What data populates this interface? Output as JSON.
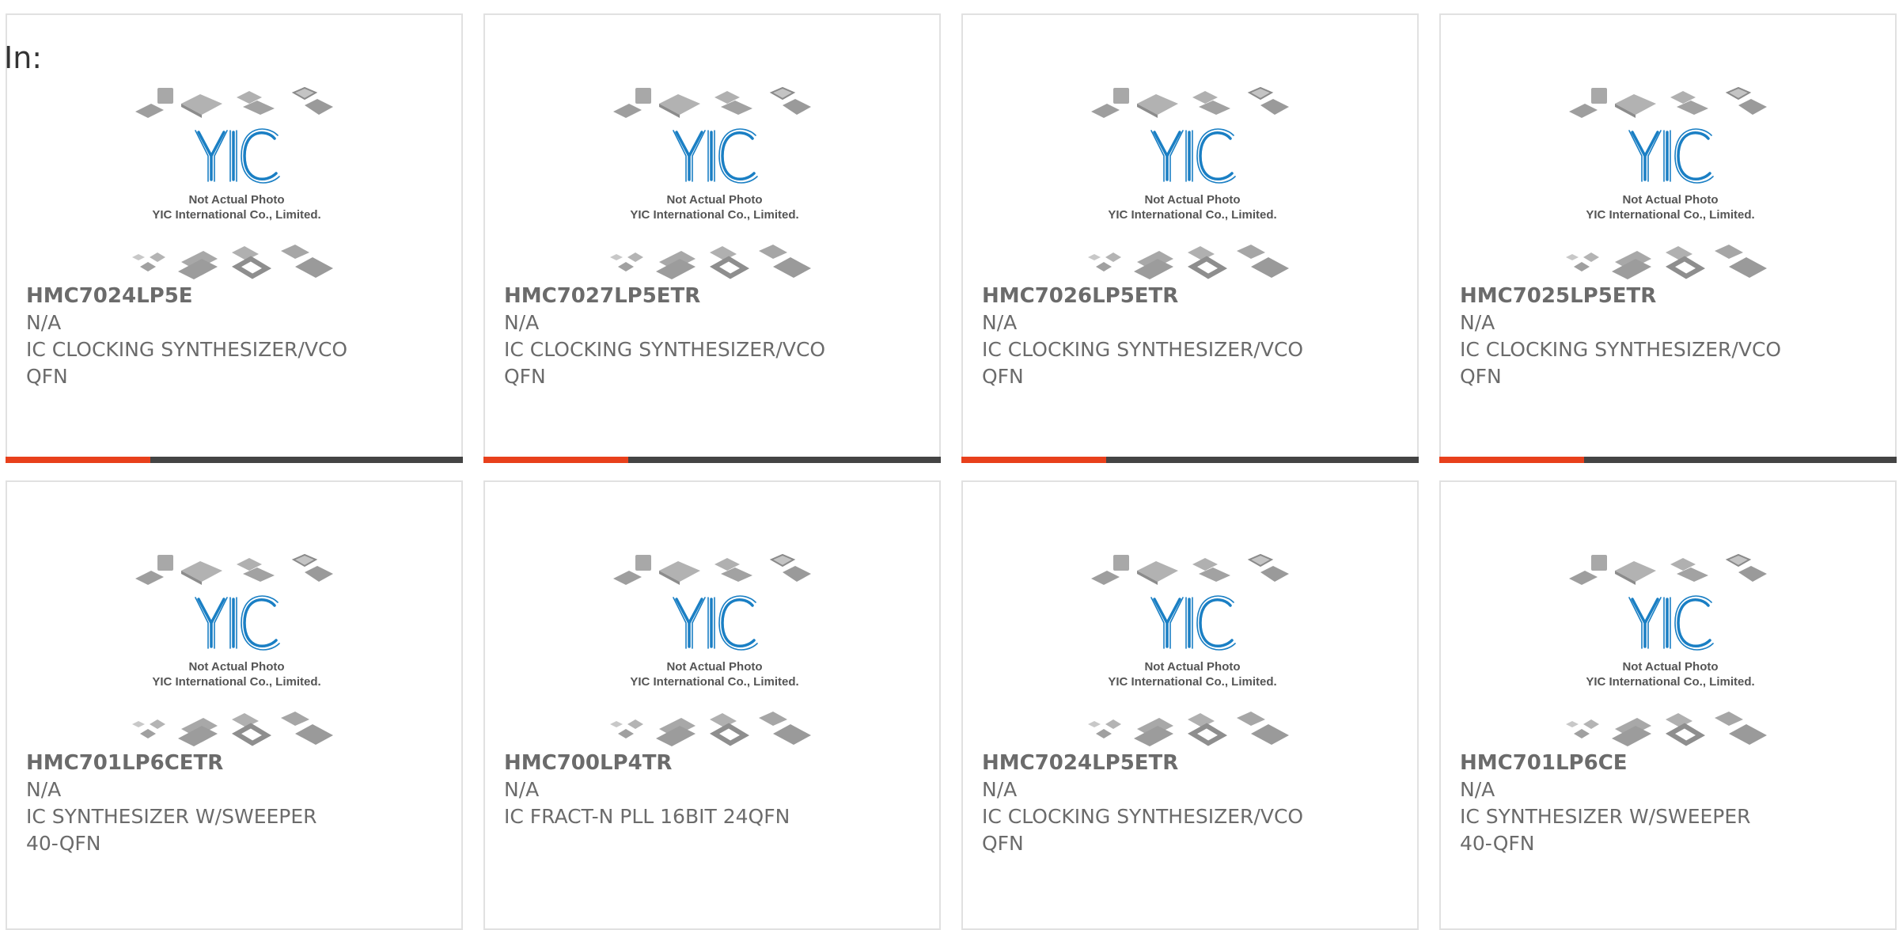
{
  "header": {
    "in_label": "In:"
  },
  "placeholder": {
    "line1": "Not Actual Photo",
    "line2": "YIC International Co., Limited.",
    "logo": "YIC"
  },
  "colors": {
    "accent": "#e8401c",
    "bar": "#444444",
    "logo_blue": "#1a7fc4",
    "chip_gray": "#b4b4b4",
    "card_border": "#e1e1e1",
    "text": "#6b6b6b"
  },
  "products": [
    {
      "part": "HMC7024LP5E",
      "mfr": "N/A",
      "desc": "IC CLOCKING SYNTHESIZER/VCO",
      "pkg": "QFN"
    },
    {
      "part": "HMC7027LP5ETR",
      "mfr": "N/A",
      "desc": "IC CLOCKING SYNTHESIZER/VCO",
      "pkg": "QFN"
    },
    {
      "part": "HMC7026LP5ETR",
      "mfr": "N/A",
      "desc": "IC CLOCKING SYNTHESIZER/VCO",
      "pkg": "QFN"
    },
    {
      "part": "HMC7025LP5ETR",
      "mfr": "N/A",
      "desc": "IC CLOCKING SYNTHESIZER/VCO",
      "pkg": "QFN"
    },
    {
      "part": "HMC701LP6CETR",
      "mfr": "N/A",
      "desc": "IC SYNTHESIZER W/SWEEPER",
      "pkg": "40-QFN"
    },
    {
      "part": "HMC700LP4TR",
      "mfr": "N/A",
      "desc": "IC FRACT-N PLL 16BIT 24QFN",
      "pkg": ""
    },
    {
      "part": "HMC7024LP5ETR",
      "mfr": "N/A",
      "desc": "IC CLOCKING SYNTHESIZER/VCO",
      "pkg": "QFN"
    },
    {
      "part": "HMC701LP6CE",
      "mfr": "N/A",
      "desc": "IC SYNTHESIZER W/SWEEPER",
      "pkg": "40-QFN"
    }
  ]
}
